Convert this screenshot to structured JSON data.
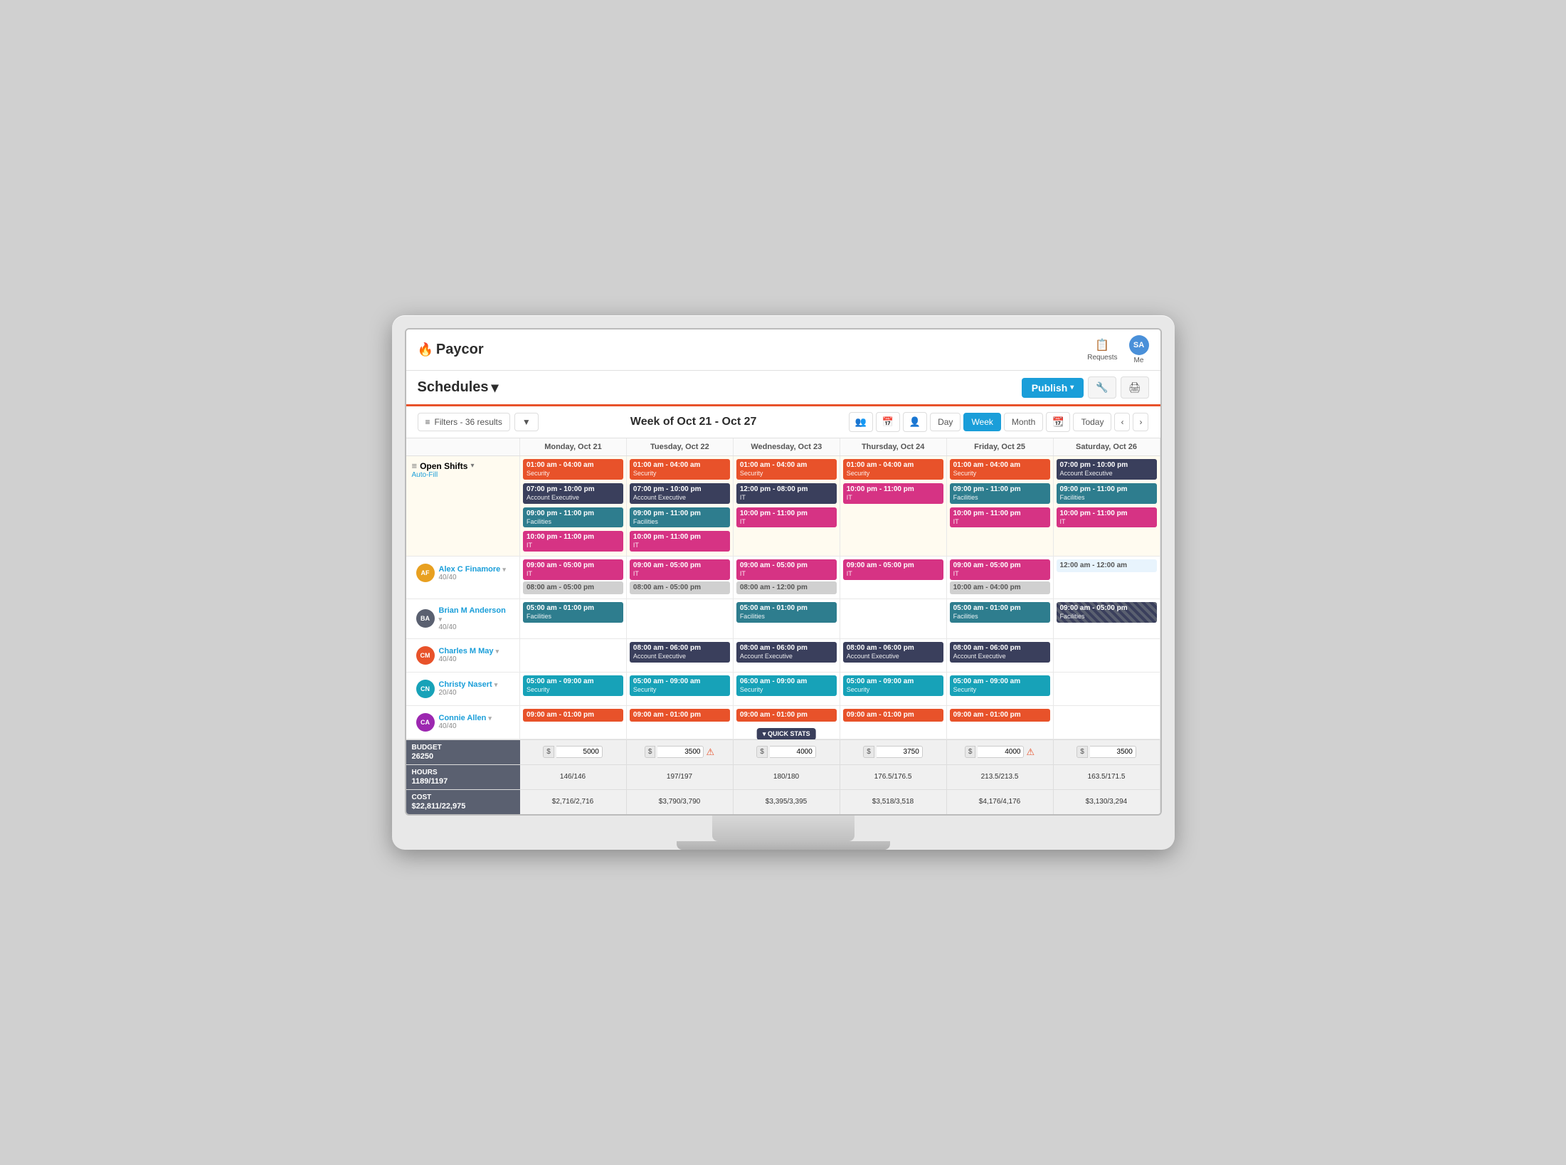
{
  "app": {
    "title": "Paycor"
  },
  "topnav": {
    "requests_label": "Requests",
    "me_label": "Me",
    "user_initials": "SA"
  },
  "header": {
    "schedules_label": "Schedules",
    "publish_label": "Publish"
  },
  "toolbar": {
    "filters_label": "Filters - 36 results",
    "week_title": "Week of Oct 21 - Oct 27",
    "day_label": "Day",
    "week_label": "Week",
    "month_label": "Month",
    "today_label": "Today"
  },
  "columns": [
    {
      "label": "Monday, Oct 21"
    },
    {
      "label": "Tuesday, Oct 22"
    },
    {
      "label": "Wednesday, Oct 23"
    },
    {
      "label": "Thursday, Oct 24"
    },
    {
      "label": "Friday, Oct 25"
    },
    {
      "label": "Saturday, Oct 26"
    }
  ],
  "open_shifts": {
    "label": "Open Shifts",
    "auto_fill": "Auto-Fill",
    "days": [
      {
        "shifts": [
          {
            "time": "01:00 am - 04:00 am",
            "dept": "Security",
            "color": "orange"
          },
          {
            "time": "07:00 pm - 10:00 pm",
            "dept": "Account Executive",
            "color": "dark"
          },
          {
            "time": "09:00 pm - 11:00 pm",
            "dept": "Facilities",
            "color": "teal"
          },
          {
            "time": "10:00 pm - 11:00 pm",
            "dept": "IT",
            "color": "pink"
          }
        ]
      },
      {
        "shifts": [
          {
            "time": "01:00 am - 04:00 am",
            "dept": "Security",
            "color": "orange"
          },
          {
            "time": "07:00 pm - 10:00 pm",
            "dept": "Account Executive",
            "color": "dark"
          },
          {
            "time": "09:00 pm - 11:00 pm",
            "dept": "Facilities",
            "color": "teal"
          },
          {
            "time": "10:00 pm - 11:00 pm",
            "dept": "IT",
            "color": "pink"
          }
        ]
      },
      {
        "shifts": [
          {
            "time": "01:00 am - 04:00 am",
            "dept": "Security",
            "color": "orange"
          },
          {
            "time": "12:00 pm - 08:00 pm",
            "dept": "IT",
            "color": "dark"
          },
          {
            "time": "10:00 pm - 11:00 pm",
            "dept": "IT",
            "color": "pink"
          }
        ]
      },
      {
        "shifts": [
          {
            "time": "01:00 am - 04:00 am",
            "dept": "Security",
            "color": "orange"
          },
          {
            "time": "10:00 pm - 11:00 pm",
            "dept": "IT",
            "color": "pink"
          }
        ]
      },
      {
        "shifts": [
          {
            "time": "01:00 am - 04:00 am",
            "dept": "Security",
            "color": "orange"
          },
          {
            "time": "09:00 pm - 11:00 pm",
            "dept": "Facilities",
            "color": "teal"
          },
          {
            "time": "10:00 pm - 11:00 pm",
            "dept": "IT",
            "color": "pink"
          }
        ]
      },
      {
        "shifts": [
          {
            "time": "07:00 pm - 10:00 pm",
            "dept": "Account Executive",
            "color": "dark"
          },
          {
            "time": "09:00 pm - 11:00 pm",
            "dept": "Facilities",
            "color": "teal"
          },
          {
            "time": "10:00 pm - 11:00 pm",
            "dept": "IT",
            "color": "pink"
          }
        ]
      }
    ]
  },
  "employees": [
    {
      "initials": "AF",
      "name": "Alex C Finamore",
      "hours": "40/40",
      "avatar_color": "#e8a020",
      "days": [
        {
          "shifts": [
            {
              "time": "09:00 am - 05:00 pm",
              "dept": "IT",
              "color": "pink"
            },
            {
              "time": "08:00 am - 05:00 pm",
              "dept": "",
              "color": "gray"
            }
          ]
        },
        {
          "shifts": [
            {
              "time": "09:00 am - 05:00 pm",
              "dept": "IT",
              "color": "pink"
            },
            {
              "time": "08:00 am - 05:00 pm",
              "dept": "",
              "color": "gray"
            }
          ]
        },
        {
          "shifts": [
            {
              "time": "09:00 am - 05:00 pm",
              "dept": "IT",
              "color": "pink"
            },
            {
              "time": "08:00 am - 12:00 pm",
              "dept": "",
              "color": "gray"
            }
          ]
        },
        {
          "shifts": [
            {
              "time": "09:00 am - 05:00 pm",
              "dept": "IT",
              "color": "pink"
            }
          ]
        },
        {
          "shifts": [
            {
              "time": "09:00 am - 05:00 pm",
              "dept": "IT",
              "color": "pink"
            },
            {
              "time": "10:00 am - 04:00 pm",
              "dept": "",
              "color": "gray"
            }
          ]
        },
        {
          "shifts": [
            {
              "time": "12:00 am - 12:00 am",
              "dept": "",
              "color": "light"
            }
          ]
        }
      ]
    },
    {
      "initials": "BA",
      "name": "Brian M Anderson",
      "hours": "40/40",
      "avatar_color": "#5a6070",
      "days": [
        {
          "shifts": [
            {
              "time": "05:00 am - 01:00 pm",
              "dept": "Facilities",
              "color": "teal"
            }
          ]
        },
        {
          "shifts": []
        },
        {
          "shifts": [
            {
              "time": "05:00 am - 01:00 pm",
              "dept": "Facilities",
              "color": "teal"
            }
          ]
        },
        {
          "shifts": []
        },
        {
          "shifts": [
            {
              "time": "05:00 am - 01:00 pm",
              "dept": "Facilities",
              "color": "teal"
            }
          ]
        },
        {
          "shifts": [
            {
              "time": "09:00 am - 05:00 pm",
              "dept": "Facilities",
              "color": "hatched"
            }
          ]
        }
      ]
    },
    {
      "initials": "CM",
      "name": "Charles M May",
      "hours": "40/40",
      "avatar_color": "#e8522a",
      "days": [
        {
          "shifts": []
        },
        {
          "shifts": [
            {
              "time": "08:00 am - 06:00 pm",
              "dept": "Account Executive",
              "color": "dark"
            }
          ]
        },
        {
          "shifts": [
            {
              "time": "08:00 am - 06:00 pm",
              "dept": "Account Executive",
              "color": "dark"
            }
          ]
        },
        {
          "shifts": [
            {
              "time": "08:00 am - 06:00 pm",
              "dept": "Account Executive",
              "color": "dark"
            }
          ]
        },
        {
          "shifts": [
            {
              "time": "08:00 am - 06:00 pm",
              "dept": "Account Executive",
              "color": "dark"
            }
          ]
        },
        {
          "shifts": []
        }
      ]
    },
    {
      "initials": "CN",
      "name": "Christy Nasert",
      "hours": "20/40",
      "avatar_color": "#17a2b8",
      "days": [
        {
          "shifts": [
            {
              "time": "05:00 am - 09:00 am",
              "dept": "Security",
              "color": "cyan"
            }
          ]
        },
        {
          "shifts": [
            {
              "time": "05:00 am - 09:00 am",
              "dept": "Security",
              "color": "cyan"
            }
          ]
        },
        {
          "shifts": [
            {
              "time": "06:00 am - 09:00 am",
              "dept": "Security",
              "color": "cyan"
            }
          ]
        },
        {
          "shifts": [
            {
              "time": "05:00 am - 09:00 am",
              "dept": "Security",
              "color": "cyan"
            }
          ]
        },
        {
          "shifts": [
            {
              "time": "05:00 am - 09:00 am",
              "dept": "Security",
              "color": "cyan"
            }
          ]
        },
        {
          "shifts": []
        }
      ]
    },
    {
      "initials": "CA",
      "name": "Connie Allen",
      "hours": "40/40",
      "avatar_color": "#9c27b0",
      "days": [
        {
          "shifts": [
            {
              "time": "09:00 am - 01:00 pm",
              "dept": "",
              "color": "orange"
            }
          ]
        },
        {
          "shifts": [
            {
              "time": "09:00 am - 01:00 pm",
              "dept": "",
              "color": "orange"
            }
          ]
        },
        {
          "shifts": [
            {
              "time": "09:00 am - 01:00 pm",
              "dept": "",
              "color": "orange"
            }
          ]
        },
        {
          "shifts": [
            {
              "time": "09:00 am - 01:00 pm",
              "dept": "",
              "color": "orange"
            }
          ]
        },
        {
          "shifts": [
            {
              "time": "09:00 am - 01:00 pm",
              "dept": "",
              "color": "orange"
            }
          ]
        },
        {
          "shifts": []
        }
      ]
    }
  ],
  "stats": {
    "budget": {
      "label": "BUDGET",
      "total": "26250",
      "days": [
        "5000",
        "3500",
        "4000",
        "3750",
        "4000",
        "3500"
      ],
      "warnings": [
        false,
        true,
        false,
        false,
        true,
        false
      ]
    },
    "hours": {
      "label": "HOURS",
      "total": "1189/1197",
      "days": [
        "146/146",
        "197/197",
        "180/180",
        "176.5/176.5",
        "213.5/213.5",
        "163.5/171.5"
      ]
    },
    "cost": {
      "label": "COST",
      "total": "$22,811/22,975",
      "days": [
        "$2,716/2,716",
        "$3,790/3,790",
        "$3,395/3,395",
        "$3,518/3,518",
        "$4,176/4,176",
        "$3,130/3,294"
      ]
    }
  },
  "quick_stats_label": "QUICK STATS"
}
